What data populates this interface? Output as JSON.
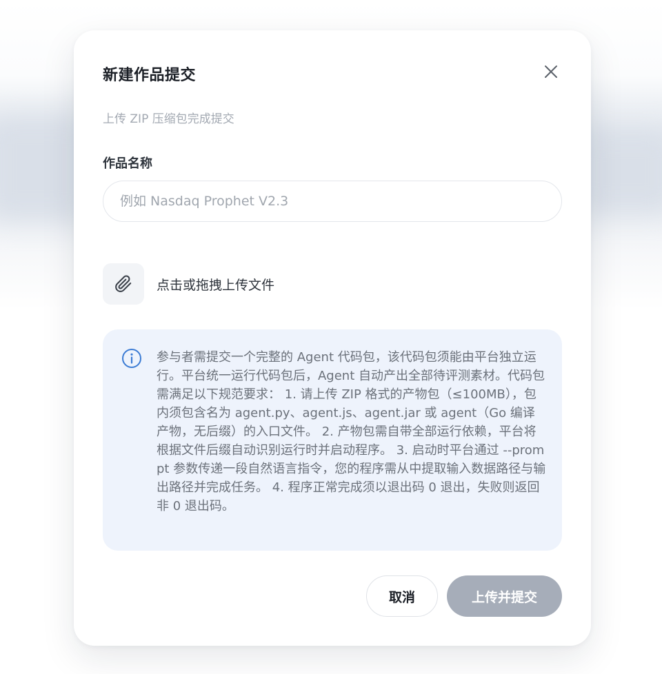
{
  "dialog": {
    "title": "新建作品提交",
    "subtitle": "上传 ZIP 压缩包完成提交",
    "close_icon": "close-icon"
  },
  "form": {
    "name_label": "作品名称",
    "name_value": "",
    "name_placeholder": "例如 Nasdaq Prophet V2.3",
    "upload_icon": "paperclip-icon",
    "upload_label": "点击或拖拽上传文件"
  },
  "info": {
    "icon": "info-icon",
    "text": "参与者需提交一个完整的 Agent 代码包，该代码包须能由平台独立运行。平台统一运行代码包后，Agent 自动产出全部待评测素材。代码包需满足以下规范要求： 1. 请上传 ZIP 格式的产物包（≤100MB），包内须包含名为 agent.py、agent.js、agent.jar 或 agent（Go 编译产物，无后缀）的入口文件。 2. 产物包需自带全部运行依赖，平台将根据文件后缀自动识别运行时并启动程序。 3. 启动时平台通过 --prompt 参数传递一段自然语言指令，您的程序需从中提取输入数据路径与输出路径并完成任务。 4. 程序正常完成须以退出码 0 退出，失败则返回非 0 退出码。"
  },
  "actions": {
    "cancel_label": "取消",
    "submit_label": "上传并提交"
  },
  "colors": {
    "info_bg": "#eef3fc",
    "info_icon": "#3b7bd4",
    "submit_disabled": "#a6adb9",
    "title_text": "#1b1f26"
  }
}
